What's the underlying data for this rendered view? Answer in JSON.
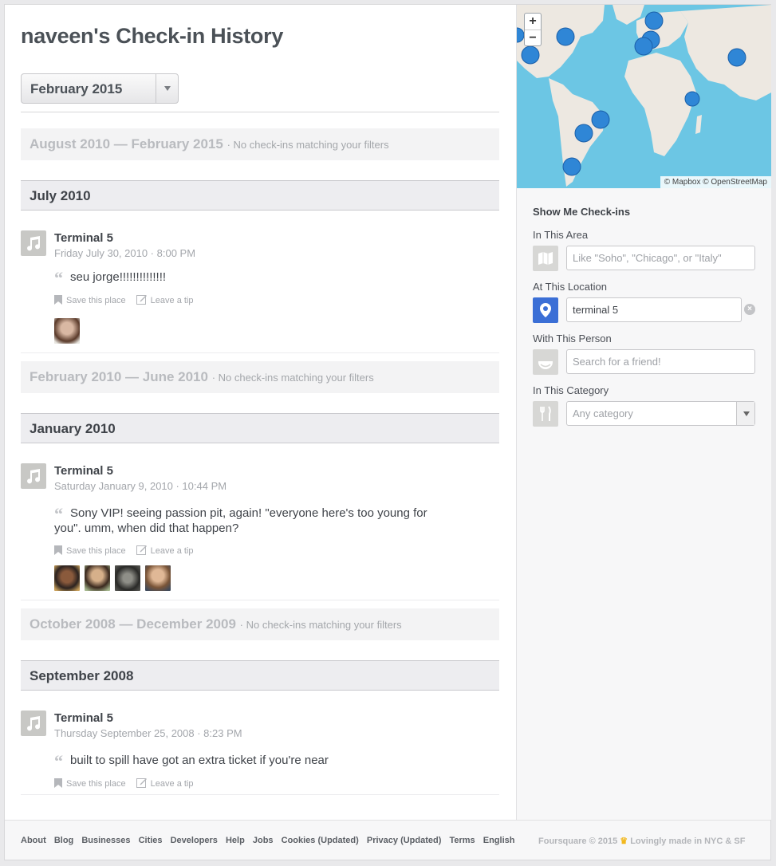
{
  "page": {
    "title": "naveen's Check-in History"
  },
  "month_filter": {
    "selected": "February 2015"
  },
  "empty_ranges": [
    {
      "range": "August 2010 — February 2015",
      "note": "· No check-ins matching your filters"
    },
    {
      "range": "February 2010 — June 2010",
      "note": "· No check-ins matching your filters"
    },
    {
      "range": "October 2008 — December 2009",
      "note": "· No check-ins matching your filters"
    }
  ],
  "months": [
    {
      "label": "July 2010",
      "checkin": {
        "venue": "Terminal 5",
        "when": "Friday July 30, 2010 · 8:00 PM",
        "shout": "seu jorge!!!!!!!!!!!!!!"
      }
    },
    {
      "label": "January 2010",
      "checkin": {
        "venue": "Terminal 5",
        "when": "Saturday January 9, 2010 · 10:44 PM",
        "shout": "Sony VIP! seeing passion pit, again! \"everyone here's too young for you\". umm, when did that happen?"
      }
    },
    {
      "label": "September 2008",
      "checkin": {
        "venue": "Terminal 5",
        "when": "Thursday September 25, 2008 · 8:23 PM",
        "shout": "built to spill have got an extra ticket if you're near"
      }
    }
  ],
  "actions": {
    "save": "Save this place",
    "tip": "Leave a tip"
  },
  "map": {
    "zoom_in": "+",
    "zoom_out": "−",
    "attribution": "© Mapbox © OpenStreetMap"
  },
  "filters": {
    "heading": "Show Me Check-ins",
    "area": {
      "label": "In This Area",
      "placeholder": "Like \"Soho\", \"Chicago\", or \"Italy\""
    },
    "location": {
      "label": "At This Location",
      "value": "terminal 5"
    },
    "person": {
      "label": "With This Person",
      "placeholder": "Search for a friend!"
    },
    "category": {
      "label": "In This Category",
      "value": "Any category"
    }
  },
  "footer": {
    "links": [
      "About",
      "Blog",
      "Businesses",
      "Cities",
      "Developers",
      "Help",
      "Jobs",
      "Cookies (Updated)",
      "Privacy (Updated)",
      "Terms",
      "English"
    ],
    "copyright": "Foursquare © 2015",
    "crown": "♛",
    "tagline": "Lovingly made in NYC & SF"
  }
}
